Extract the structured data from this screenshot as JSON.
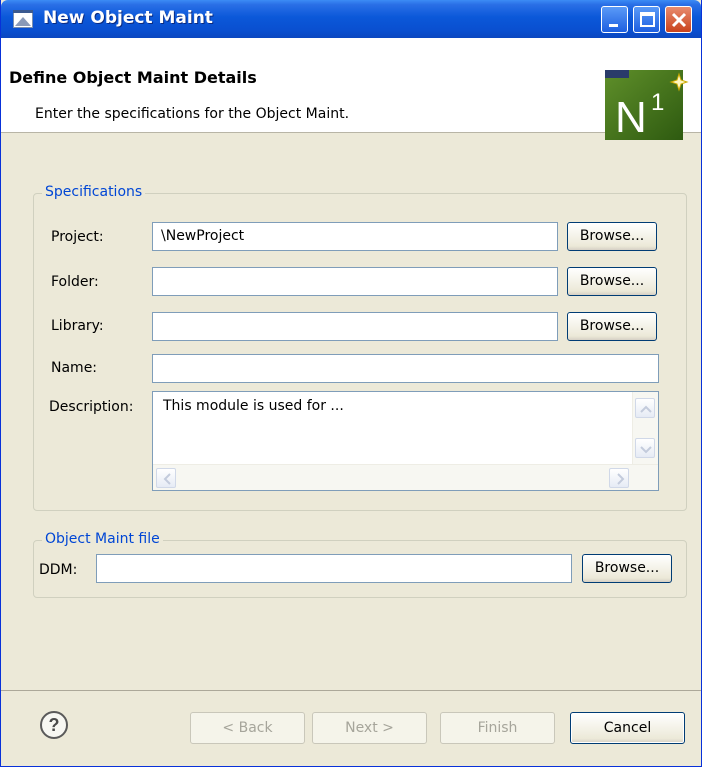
{
  "window": {
    "title": "New Object Maint"
  },
  "header": {
    "title": "Define Object Maint Details",
    "description": "Enter the specifications for the Object Maint.",
    "logo": {
      "letter": "N",
      "superscript": "1"
    }
  },
  "specifications": {
    "label": "Specifications",
    "project": {
      "label": "Project:",
      "value": "\\NewProject",
      "browse": "Browse..."
    },
    "folder": {
      "label": "Folder:",
      "value": "",
      "browse": "Browse..."
    },
    "library": {
      "label": "Library:",
      "value": "",
      "browse": "Browse..."
    },
    "name": {
      "label": "Name:",
      "value": ""
    },
    "description": {
      "label": "Description:",
      "value": "This module is used for ..."
    }
  },
  "object_maint_file": {
    "label": "Object Maint file",
    "ddm": {
      "label": "DDM:",
      "value": "",
      "browse": "Browse..."
    }
  },
  "footer": {
    "back": "< Back",
    "next": "Next >",
    "finish": "Finish",
    "cancel": "Cancel"
  },
  "icons": [
    "app-icon",
    "minimize-icon",
    "maximize-icon",
    "close-icon",
    "help-icon",
    "scroll-up-icon",
    "scroll-down-icon",
    "scroll-left-icon",
    "scroll-right-icon"
  ]
}
